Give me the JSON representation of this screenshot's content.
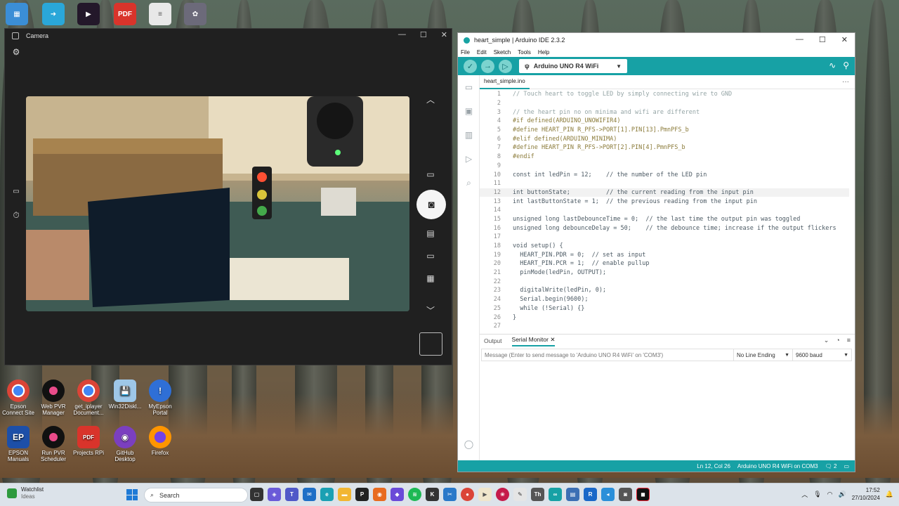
{
  "camera": {
    "title": "Camera"
  },
  "ide": {
    "title": "heart_simple | Arduino IDE 2.3.2",
    "menu": [
      "File",
      "Edit",
      "Sketch",
      "Tools",
      "Help"
    ],
    "board": "Arduino UNO R4 WiFi",
    "file_tab": "heart_simple.ino",
    "code": [
      {
        "n": "1",
        "t": "// Touch heart to toggle LED by simply connecting wire to GND",
        "s": "c"
      },
      {
        "n": "2",
        "t": "",
        "s": ""
      },
      {
        "n": "3",
        "t": "// the heart pin no on minima and wifi are different",
        "s": "c"
      },
      {
        "n": "4",
        "t": "#if defined(ARDUINO_UNOWIFIR4)",
        "s": "p"
      },
      {
        "n": "5",
        "t": "#define HEART_PIN R_PFS->PORT[1].PIN[13].PmnPFS_b",
        "s": "p"
      },
      {
        "n": "6",
        "t": "#elif defined(ARDUINO_MINIMA)",
        "s": "p"
      },
      {
        "n": "7",
        "t": "#define HEART_PIN R_PFS->PORT[2].PIN[4].PmnPFS_b",
        "s": "p"
      },
      {
        "n": "8",
        "t": "#endif",
        "s": "p"
      },
      {
        "n": "9",
        "t": "",
        "s": ""
      },
      {
        "n": "10",
        "t": "const int ledPin = 12;    // the number of the LED pin",
        "s": ""
      },
      {
        "n": "11",
        "t": "",
        "s": ""
      },
      {
        "n": "12",
        "t": "int buttonState;          // the current reading from the input pin",
        "s": ""
      },
      {
        "n": "13",
        "t": "int lastButtonState = 1;  // the previous reading from the input pin",
        "s": ""
      },
      {
        "n": "14",
        "t": "",
        "s": ""
      },
      {
        "n": "15",
        "t": "unsigned long lastDebounceTime = 0;  // the last time the output pin was toggled",
        "s": ""
      },
      {
        "n": "16",
        "t": "unsigned long debounceDelay = 50;    // the debounce time; increase if the output flickers",
        "s": ""
      },
      {
        "n": "17",
        "t": "",
        "s": ""
      },
      {
        "n": "18",
        "t": "void setup() {",
        "s": ""
      },
      {
        "n": "19",
        "t": "  HEART_PIN.PDR = 0;  // set as input",
        "s": ""
      },
      {
        "n": "20",
        "t": "  HEART_PIN.PCR = 1;  // enable pullup",
        "s": ""
      },
      {
        "n": "21",
        "t": "  pinMode(ledPin, OUTPUT);",
        "s": ""
      },
      {
        "n": "22",
        "t": "",
        "s": ""
      },
      {
        "n": "23",
        "t": "  digitalWrite(ledPin, 0);",
        "s": ""
      },
      {
        "n": "24",
        "t": "  Serial.begin(9600);",
        "s": ""
      },
      {
        "n": "25",
        "t": "  while (!Serial) {}",
        "s": ""
      },
      {
        "n": "26",
        "t": "}",
        "s": ""
      },
      {
        "n": "27",
        "t": "",
        "s": ""
      }
    ],
    "highlight_line": "12",
    "panel": {
      "output_tab": "Output",
      "serial_tab": "Serial Monitor",
      "message_placeholder": "Message (Enter to send message to 'Arduino UNO R4 WiFi' on 'COM3')",
      "line_ending": "No Line Ending",
      "baud": "9600 baud"
    },
    "status": {
      "cursor": "Ln 12, Col 26",
      "board_port": "Arduino UNO R4 WiFi on COM3",
      "notifications": "2"
    }
  },
  "desktop_icons": [
    {
      "label": "Epson Connect Site",
      "icon": "chrome-icon"
    },
    {
      "label": "Web PVR Manager",
      "icon": "pvr-icon"
    },
    {
      "label": "get_iplayer Document...",
      "icon": "chrome-icon"
    },
    {
      "label": "Win32Diskl...",
      "icon": "disk-icon"
    },
    {
      "label": "MyEpson Portal",
      "icon": "info-icon"
    },
    {
      "label": "EPSON Manuals",
      "icon": "epson-icon"
    },
    {
      "label": "Run PVR Scheduler",
      "icon": "pvr-icon"
    },
    {
      "label": "Projects RPi",
      "icon": "pdf-icon"
    },
    {
      "label": "GitHub Desktop",
      "icon": "github-icon"
    },
    {
      "label": "Firefox",
      "icon": "firefox-icon"
    }
  ],
  "taskbar": {
    "widget_title": "Watchlist",
    "widget_sub": "Ideas",
    "search": "Search",
    "time": "17:52",
    "date": "27/10/2024"
  },
  "colors": {
    "arduino_teal": "#17a1a5"
  }
}
